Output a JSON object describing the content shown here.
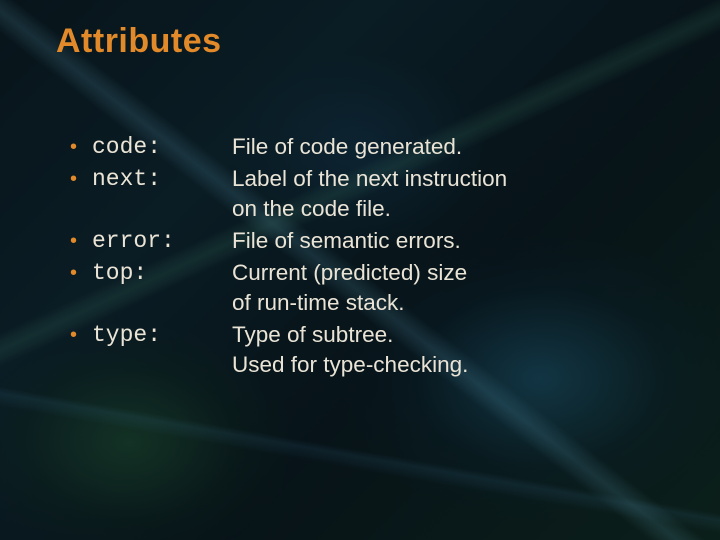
{
  "title": "Attributes",
  "bullet": "•",
  "items": [
    {
      "term": "code:",
      "lines": [
        "File of code generated."
      ]
    },
    {
      "term": "next:",
      "lines": [
        "Label of the next instruction",
        "on the code file."
      ]
    },
    {
      "term": "error:",
      "lines": [
        "File of semantic errors."
      ]
    },
    {
      "term": "top:",
      "lines": [
        "Current (predicted) size",
        "of run-time stack."
      ]
    },
    {
      "term": "type:",
      "lines": [
        "Type of subtree.",
        "Used for type-checking."
      ]
    }
  ]
}
